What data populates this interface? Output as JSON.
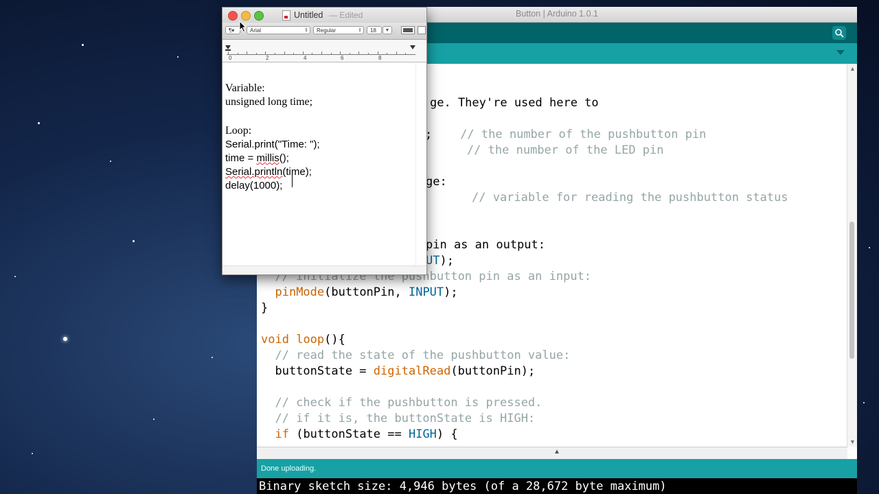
{
  "arduino": {
    "window_title": "Button | Arduino 1.0.1",
    "code_lines": [
      {
        "parts": [
          {
            "t": "ge. They're used here to",
            "c": "plain"
          }
        ]
      },
      {
        "parts": [
          {
            "t": ";",
            "c": "plain"
          },
          {
            "t": "    // the number of the pushbutton pin",
            "c": "comment"
          }
        ]
      },
      {
        "parts": [
          {
            "t": "    // the number of the LED pin",
            "c": "comment"
          }
        ]
      },
      {
        "parts": [
          {
            "t": "ge:",
            "c": "plain"
          }
        ]
      },
      {
        "parts": [
          {
            "t": "// variable for reading the pushbutton status",
            "c": "comment"
          }
        ]
      },
      {
        "parts": [
          {
            "t": "pin as an output:",
            "c": "plain"
          }
        ]
      },
      {
        "parts": [
          {
            "t": "UT",
            "c": "const"
          },
          {
            "t": ");",
            "c": "plain"
          }
        ]
      },
      {
        "parts": [
          {
            "t": "  // initialize the pushbutton pin as an input:",
            "c": "comment"
          }
        ]
      },
      {
        "parts": [
          {
            "t": "  ",
            "c": "plain"
          },
          {
            "t": "pinMode",
            "c": "keyword"
          },
          {
            "t": "(buttonPin, ",
            "c": "plain"
          },
          {
            "t": "INPUT",
            "c": "const"
          },
          {
            "t": ");",
            "c": "plain"
          }
        ]
      },
      {
        "parts": [
          {
            "t": "}",
            "c": "plain"
          }
        ]
      },
      {
        "parts": [
          {
            "t": "void",
            "c": "keyword"
          },
          {
            "t": " ",
            "c": "plain"
          },
          {
            "t": "loop",
            "c": "keyword"
          },
          {
            "t": "(){",
            "c": "plain"
          }
        ]
      },
      {
        "parts": [
          {
            "t": "  // read the state of the pushbutton value:",
            "c": "comment"
          }
        ]
      },
      {
        "parts": [
          {
            "t": "  buttonState = ",
            "c": "plain"
          },
          {
            "t": "digitalRead",
            "c": "keyword"
          },
          {
            "t": "(buttonPin);",
            "c": "plain"
          }
        ]
      },
      {
        "parts": [
          {
            "t": "  // check if the pushbutton is pressed.",
            "c": "comment"
          }
        ]
      },
      {
        "parts": [
          {
            "t": "  // if it is, the buttonState is HIGH:",
            "c": "comment"
          }
        ]
      },
      {
        "parts": [
          {
            "t": "  ",
            "c": "plain"
          },
          {
            "t": "if",
            "c": "keyword"
          },
          {
            "t": " (buttonState == ",
            "c": "plain"
          },
          {
            "t": "HIGH",
            "c": "const"
          },
          {
            "t": ") {",
            "c": "plain"
          }
        ]
      }
    ],
    "status_message": "Done uploading.",
    "console_message": "Binary sketch size: 4,946 bytes (of a 28,672 byte maximum)",
    "colors": {
      "toolbar": "#006468",
      "tabbar": "#17a1a5",
      "keyword": "#cc6600",
      "constant": "#006699",
      "comment": "#95a5a6"
    }
  },
  "textedit": {
    "title": "Untitled",
    "edited_label": "— Edited",
    "format_bar": {
      "paragraph": "¶▾",
      "font": "Arial",
      "typeface": "Regular",
      "size": "18"
    },
    "ruler_numbers": [
      "0",
      "2",
      "4",
      "6",
      "8"
    ],
    "doc_lines": [
      {
        "text": "Variable:",
        "font": "serif"
      },
      {
        "text": "unsigned long time;",
        "font": "serif"
      },
      {
        "text": "",
        "font": "serif"
      },
      {
        "text": "Loop:",
        "font": "serif"
      },
      {
        "text": "Serial.print(\"Time: \");",
        "font": "sans"
      },
      {
        "text": "time = millis();",
        "font": "sans",
        "misspelled": "millis"
      },
      {
        "text": "Serial.println(time);",
        "font": "sans",
        "misspelled": "Serial.println"
      },
      {
        "text": "delay(1000);",
        "font": "sans"
      }
    ]
  },
  "icons": [
    "close-icon",
    "minimize-icon",
    "zoom-icon",
    "document-icon",
    "serial-monitor-icon",
    "mouse-cursor-icon"
  ]
}
